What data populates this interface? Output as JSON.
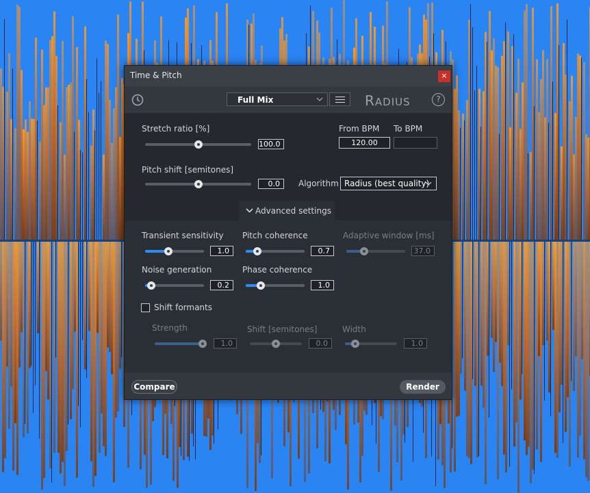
{
  "dialog": {
    "title": "Time & Pitch",
    "close_label": "×"
  },
  "toolbar": {
    "preset": "Full Mix",
    "logo_big": "R",
    "logo_rest": "ADIUS",
    "help_label": "?"
  },
  "main": {
    "stretch_label": "Stretch ratio [%]",
    "stretch_value": "100.0",
    "stretch_level": 0.5,
    "from_bpm_label": "From BPM",
    "from_bpm_value": "120.00",
    "to_bpm_label": "To BPM",
    "to_bpm_value": "",
    "pitch_label": "Pitch shift [semitones]",
    "pitch_value": "0.0",
    "pitch_level": 0.5,
    "algorithm_label": "Algorithm",
    "algorithm_value": "Radius (best quality)"
  },
  "advanced": {
    "toggle_label": "Advanced settings",
    "transient_label": "Transient sensitivity",
    "transient_value": "1.0",
    "transient_level": 0.4,
    "pitch_coh_label": "Pitch coherence",
    "pitch_coh_value": "0.7",
    "pitch_coh_level": 0.2,
    "adaptive_label": "Adaptive window [ms]",
    "adaptive_value": "37.0",
    "adaptive_level": 0.3,
    "noise_label": "Noise generation",
    "noise_value": "0.2",
    "noise_level": 0.1,
    "phase_coh_label": "Phase coherence",
    "phase_coh_value": "1.0",
    "phase_coh_level": 0.25,
    "shift_formants_label": "Shift formants",
    "strength_label": "Strength",
    "strength_value": "1.0",
    "strength_level": 0.92,
    "shift_label": "Shift [semitones]",
    "shift_value": "0.0",
    "shift_level": 0.5,
    "width_label": "Width",
    "width_value": "1.0",
    "width_level": 0.2
  },
  "footer": {
    "compare_label": "Compare",
    "render_label": "Render"
  },
  "colors": {
    "accent": "#2f8cf2",
    "background": "#2a84f2",
    "spectrum": "#e08a2a"
  }
}
